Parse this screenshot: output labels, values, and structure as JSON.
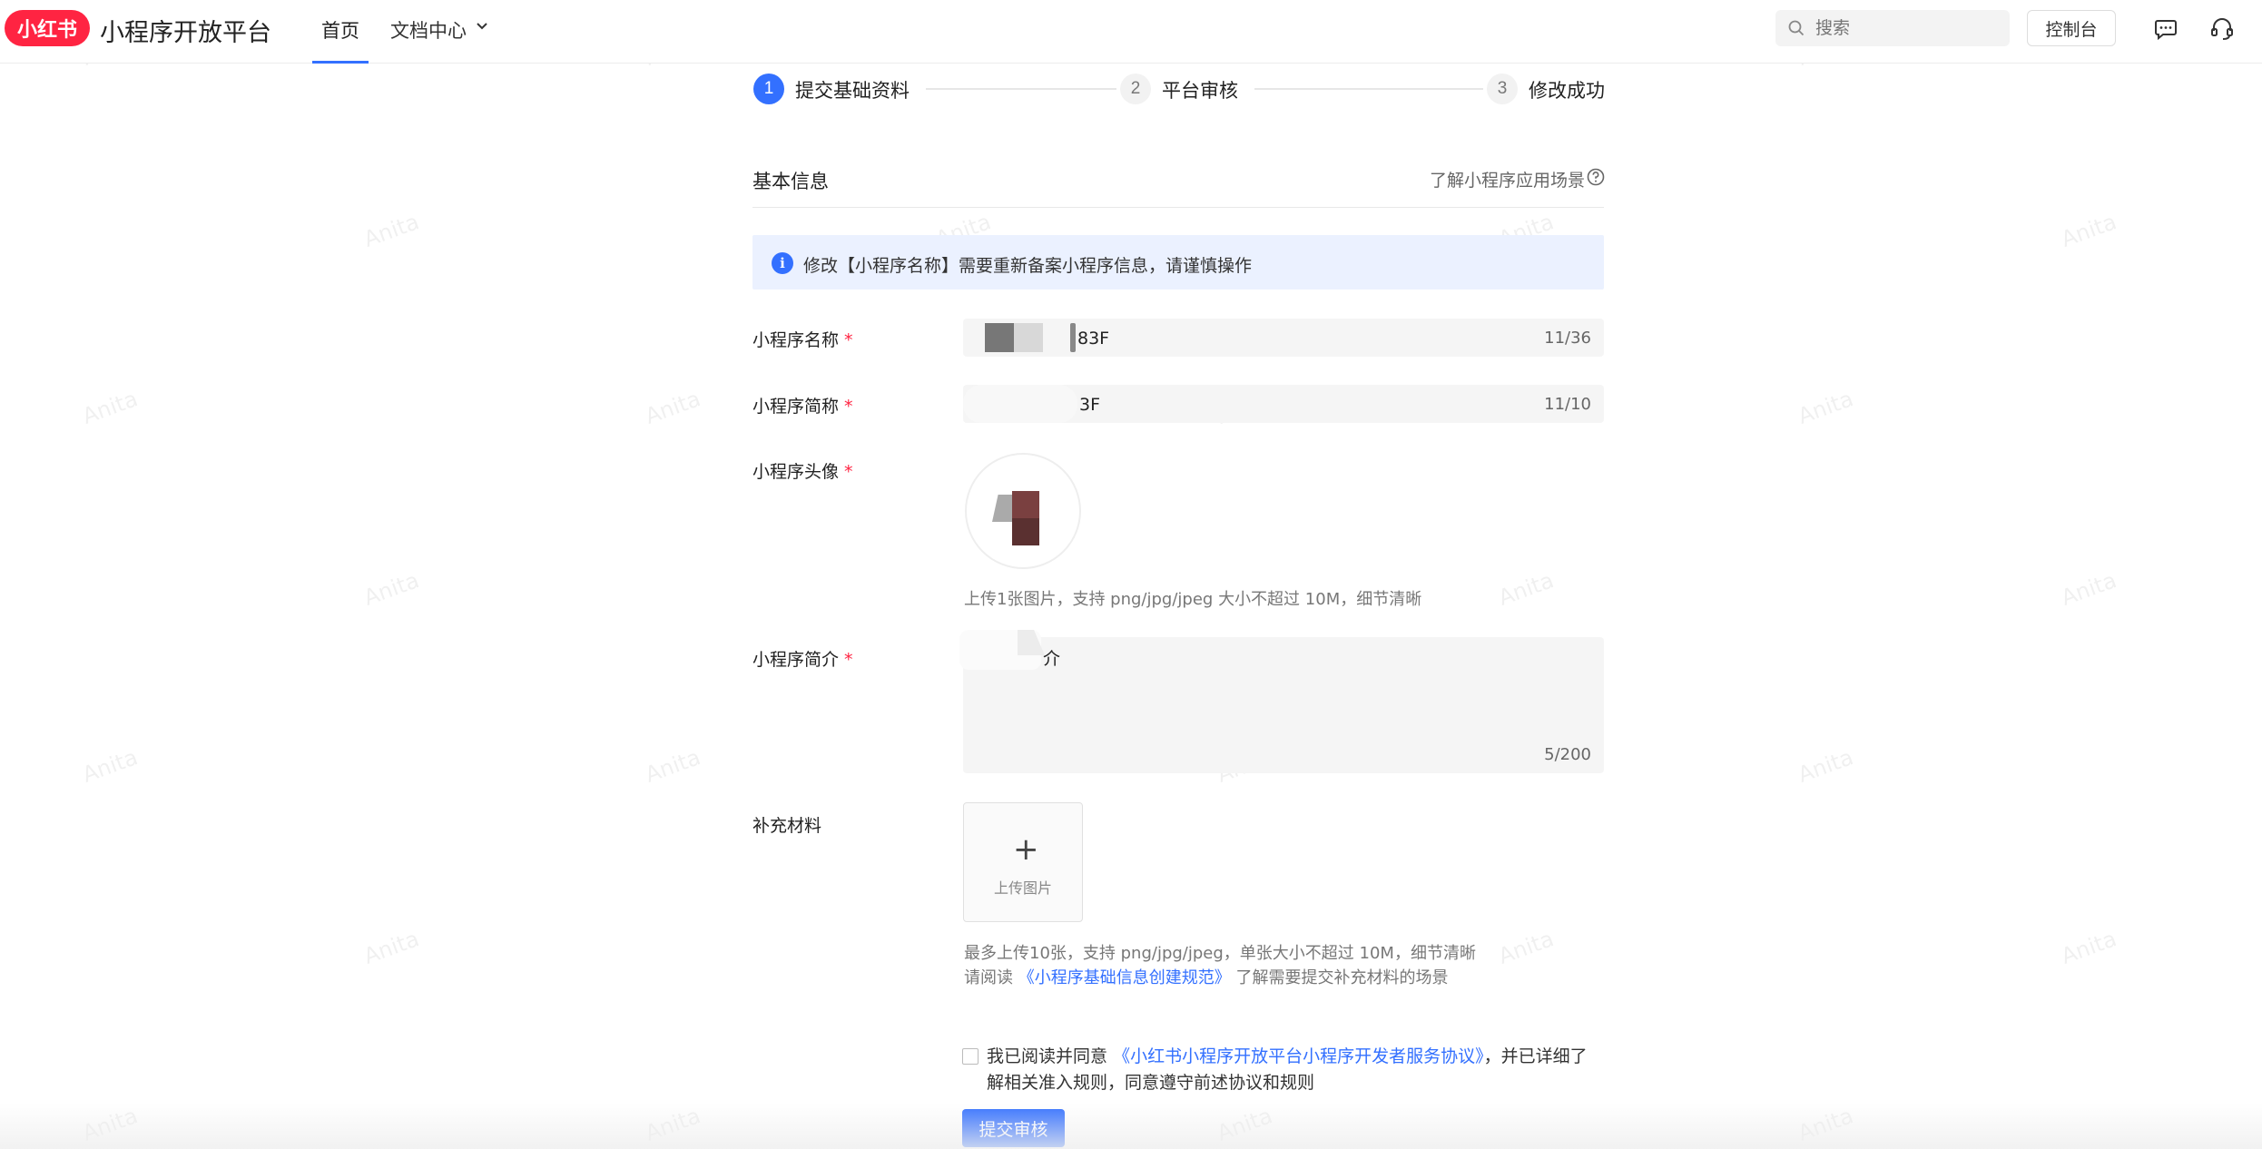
{
  "header": {
    "logo_text": "小红书",
    "brand_title": "小程序开放平台",
    "nav": {
      "home": "首页",
      "docs": "文档中心"
    },
    "search_placeholder": "搜索",
    "console_label": "控制台"
  },
  "steps": [
    {
      "num": "1",
      "label": "提交基础资料"
    },
    {
      "num": "2",
      "label": "平台审核"
    },
    {
      "num": "3",
      "label": "修改成功"
    }
  ],
  "section": {
    "title": "基本信息",
    "help_link": "了解小程序应用场景"
  },
  "notice": "修改【小程序名称】需要重新备案小程序信息，请谨慎操作",
  "form": {
    "name": {
      "label": "小程序名称",
      "required": "*",
      "value": "83F",
      "count": "11/36"
    },
    "short_name": {
      "label": "小程序简称",
      "required": "*",
      "value": "3F",
      "count": "11/10"
    },
    "avatar": {
      "label": "小程序头像",
      "required": "*",
      "hint": "上传1张图片，支持 png/jpg/jpeg 大小不超过 10M，细节清晰"
    },
    "intro": {
      "label": "小程序简介",
      "required": "*",
      "value": "介",
      "count": "5/200"
    },
    "materials": {
      "label": "补充材料",
      "upload_label": "上传图片",
      "hint1": "最多上传10张，支持 png/jpg/jpeg，单张大小不超过 10M，细节清晰",
      "hint2_prefix": "请阅读",
      "hint2_link": "《小程序基础信息创建规范》",
      "hint2_suffix": "了解需要提交补充材料的场景"
    }
  },
  "agreement": {
    "prefix": "我已阅读并同意",
    "link": "《小红书小程序开放平台小程序开发者服务协议》",
    "suffix": "，并已详细了解相关准入规则，同意遵守前述协议和规则"
  },
  "submit_label": "提交审核",
  "watermark": "Anita",
  "colors": {
    "brand": "#ff2442",
    "accent": "#3370ff",
    "notice_bg": "#ebf1ff"
  }
}
